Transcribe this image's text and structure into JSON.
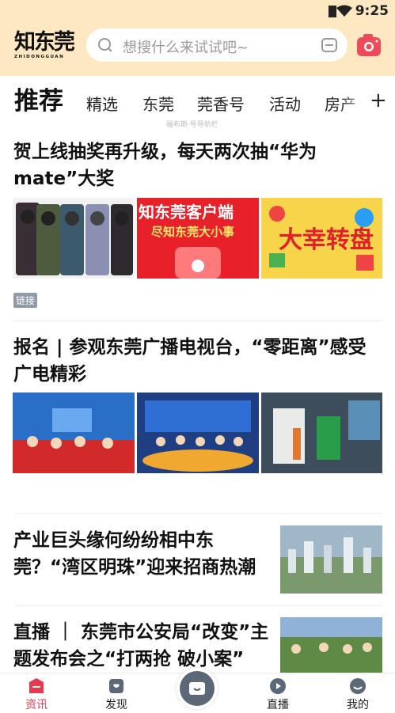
{
  "status": {
    "time": "9:25"
  },
  "brand": {
    "logo_text": "知东莞",
    "logo_sub": "ZHIDONGGUAN"
  },
  "search": {
    "placeholder": "想搜什么来试试吧~"
  },
  "tabs": [
    {
      "label": "推荐"
    },
    {
      "label": "精选"
    },
    {
      "label": "东莞"
    },
    {
      "label": "莞香号"
    },
    {
      "label": "活动"
    },
    {
      "label": "房产"
    }
  ],
  "tabs_more": "+",
  "faint_text": "福布斯·号导航栏",
  "articles": [
    {
      "title_line1": "贺上线抽奖再升级，每天两次抽“华为",
      "title_line2": "mate”大奖",
      "tag": "链接",
      "images": [
        "phones",
        "client-promo",
        "lucky-wheel"
      ],
      "image_texts": {
        "promo_title": "知东莞客户端",
        "promo_sub": "尽知东莞大小事",
        "wheel_line1": "大幸",
        "wheel_line2": "转盘"
      }
    },
    {
      "title_line1": "报名 | 参观东莞广播电视台，“零距离”感受",
      "title_line2": "广电精彩",
      "images": [
        "studio-kids",
        "newsroom-group",
        "exhibit-hall"
      ]
    },
    {
      "title_line1": "产业巨头缘何纷纷相中东",
      "title_line2": "莞？“湾区明珠”迎来招商热潮",
      "image": "city-aerial"
    },
    {
      "title_line1": "直播 ｜ 东莞市公安局“改变”主",
      "title_line2": "题发布会之“打两抢 破小案”",
      "image": "cyclists"
    }
  ],
  "bottom_nav": [
    {
      "label": "资讯",
      "active": true
    },
    {
      "label": "发现",
      "active": false
    },
    {
      "label": "",
      "active": false
    },
    {
      "label": "直播",
      "active": false
    },
    {
      "label": "我的",
      "active": false
    }
  ],
  "colors": {
    "header_bg": "#fde8c2",
    "accent": "#e8384e",
    "tag_bg": "#8e9aa6"
  }
}
